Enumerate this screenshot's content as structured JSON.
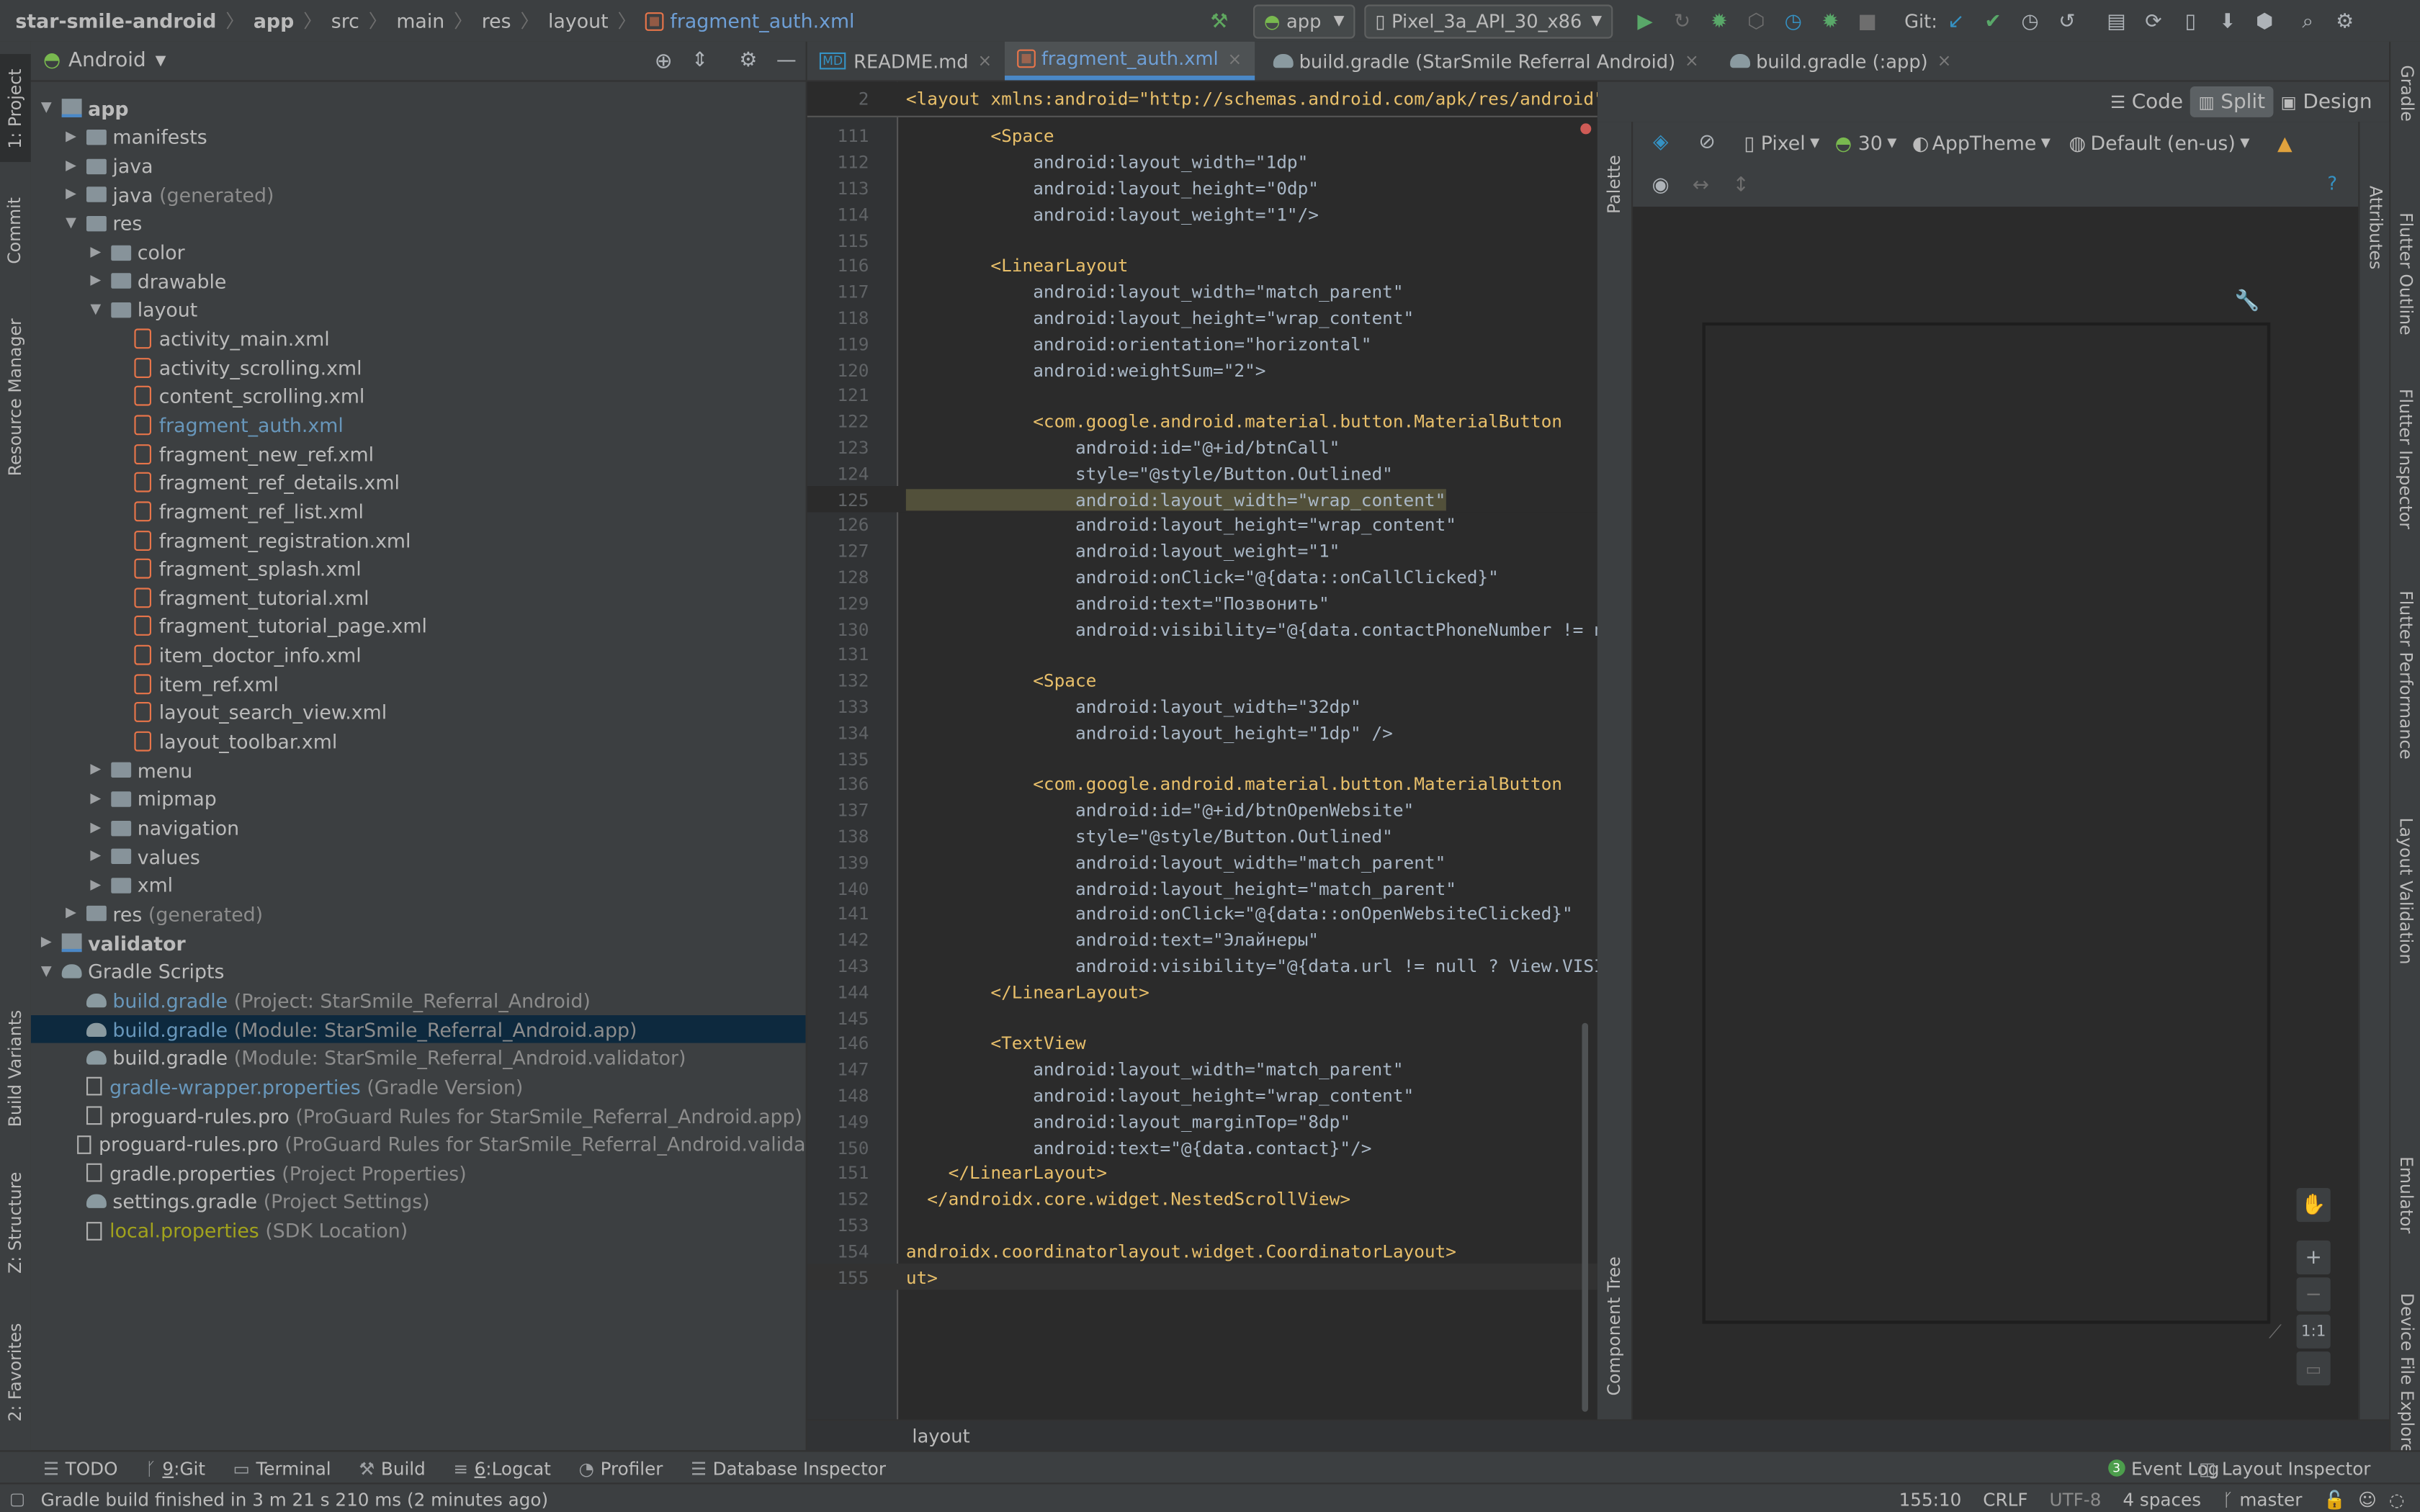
{
  "navbar": {
    "crumbs": [
      "star-smile-android",
      "app",
      "src",
      "main",
      "res",
      "layout",
      "fragment_auth.xml"
    ],
    "run_config": "app",
    "device": "Pixel_3a_API_30_x86",
    "git_label": "Git:"
  },
  "left_stripe": [
    "1: Project",
    "Commit",
    "Resource Manager",
    "Build Variants",
    "Z: Structure",
    "2: Favorites"
  ],
  "right_stripe": [
    "Gradle",
    "Attributes",
    "Flutter Outline",
    "Flutter Inspector",
    "Flutter Performance",
    "Layout Validation",
    "Emulator",
    "Device File Explorer"
  ],
  "project": {
    "view_selector": "Android",
    "rows": [
      {
        "label": "app",
        "depth": 0,
        "arrow": "▼",
        "kind": "module",
        "bold": true
      },
      {
        "label": "manifests",
        "depth": 1,
        "arrow": "▶",
        "kind": "folder"
      },
      {
        "label": "java",
        "depth": 1,
        "arrow": "▶",
        "kind": "folder"
      },
      {
        "label": "java",
        "suffix": "(generated)",
        "depth": 1,
        "arrow": "▶",
        "kind": "folder"
      },
      {
        "label": "res",
        "depth": 1,
        "arrow": "▼",
        "kind": "folder"
      },
      {
        "label": "color",
        "depth": 2,
        "arrow": "▶",
        "kind": "folder"
      },
      {
        "label": "drawable",
        "depth": 2,
        "arrow": "▶",
        "kind": "folder"
      },
      {
        "label": "layout",
        "depth": 2,
        "arrow": "▼",
        "kind": "folder"
      },
      {
        "label": "activity_main.xml",
        "depth": 3,
        "kind": "xml"
      },
      {
        "label": "activity_scrolling.xml",
        "depth": 3,
        "kind": "xml"
      },
      {
        "label": "content_scrolling.xml",
        "depth": 3,
        "kind": "xml"
      },
      {
        "label": "fragment_auth.xml",
        "depth": 3,
        "kind": "xml",
        "color": "blue"
      },
      {
        "label": "fragment_new_ref.xml",
        "depth": 3,
        "kind": "xml"
      },
      {
        "label": "fragment_ref_details.xml",
        "depth": 3,
        "kind": "xml"
      },
      {
        "label": "fragment_ref_list.xml",
        "depth": 3,
        "kind": "xml"
      },
      {
        "label": "fragment_registration.xml",
        "depth": 3,
        "kind": "xml"
      },
      {
        "label": "fragment_splash.xml",
        "depth": 3,
        "kind": "xml"
      },
      {
        "label": "fragment_tutorial.xml",
        "depth": 3,
        "kind": "xml"
      },
      {
        "label": "fragment_tutorial_page.xml",
        "depth": 3,
        "kind": "xml"
      },
      {
        "label": "item_doctor_info.xml",
        "depth": 3,
        "kind": "xml"
      },
      {
        "label": "item_ref.xml",
        "depth": 3,
        "kind": "xml"
      },
      {
        "label": "layout_search_view.xml",
        "depth": 3,
        "kind": "xml"
      },
      {
        "label": "layout_toolbar.xml",
        "depth": 3,
        "kind": "xml"
      },
      {
        "label": "menu",
        "depth": 2,
        "arrow": "▶",
        "kind": "folder"
      },
      {
        "label": "mipmap",
        "depth": 2,
        "arrow": "▶",
        "kind": "folder"
      },
      {
        "label": "navigation",
        "depth": 2,
        "arrow": "▶",
        "kind": "folder"
      },
      {
        "label": "values",
        "depth": 2,
        "arrow": "▶",
        "kind": "folder"
      },
      {
        "label": "xml",
        "depth": 2,
        "arrow": "▶",
        "kind": "folder"
      },
      {
        "label": "res",
        "suffix": "(generated)",
        "depth": 1,
        "arrow": "▶",
        "kind": "folder"
      },
      {
        "label": "validator",
        "depth": 0,
        "arrow": "▶",
        "kind": "module",
        "bold": true
      },
      {
        "label": "Gradle Scripts",
        "depth": 0,
        "arrow": "▼",
        "kind": "gradle"
      },
      {
        "label": "build.gradle",
        "suffix": "(Project: StarSmile_Referral_Android)",
        "depth": 1,
        "kind": "gradle",
        "color": "blue"
      },
      {
        "label": "build.gradle",
        "suffix": "(Module: StarSmile_Referral_Android.app)",
        "depth": 1,
        "kind": "gradle",
        "color": "blue",
        "selected": true
      },
      {
        "label": "build.gradle",
        "suffix": "(Module: StarSmile_Referral_Android.validator)",
        "depth": 1,
        "kind": "gradle"
      },
      {
        "label": "gradle-wrapper.properties",
        "suffix": "(Gradle Version)",
        "depth": 1,
        "kind": "prop",
        "color": "blue"
      },
      {
        "label": "proguard-rules.pro",
        "suffix": "(ProGuard Rules for StarSmile_Referral_Android.app)",
        "depth": 1,
        "kind": "prop"
      },
      {
        "label": "proguard-rules.pro",
        "suffix": "(ProGuard Rules for StarSmile_Referral_Android.valida",
        "depth": 1,
        "kind": "prop"
      },
      {
        "label": "gradle.properties",
        "suffix": "(Project Properties)",
        "depth": 1,
        "kind": "prop"
      },
      {
        "label": "settings.gradle",
        "suffix": "(Project Settings)",
        "depth": 1,
        "kind": "gradle"
      },
      {
        "label": "local.properties",
        "suffix": "(SDK Location)",
        "depth": 1,
        "kind": "prop",
        "color": "olive"
      }
    ]
  },
  "editor_tabs": [
    {
      "label": "README.md",
      "active": false
    },
    {
      "label": "fragment_auth.xml",
      "active": true
    },
    {
      "label": "build.gradle (StarSmile Referral Android)",
      "active": false
    },
    {
      "label": "build.gradle (:app)",
      "active": false
    }
  ],
  "sticky": {
    "line": "2",
    "text": "<layout xmlns:android=\"http://schemas.android.com/apk/res/android\""
  },
  "code": [
    {
      "n": "111",
      "t": "        <Space"
    },
    {
      "n": "112",
      "t": "            android:layout_width=\"1dp\""
    },
    {
      "n": "113",
      "t": "            android:layout_height=\"0dp\""
    },
    {
      "n": "114",
      "t": "            android:layout_weight=\"1\"/>"
    },
    {
      "n": "115",
      "t": ""
    },
    {
      "n": "116",
      "t": "        <LinearLayout"
    },
    {
      "n": "117",
      "t": "            android:layout_width=\"match_parent\""
    },
    {
      "n": "118",
      "t": "            android:layout_height=\"wrap_content\""
    },
    {
      "n": "119",
      "t": "            android:orientation=\"horizontal\""
    },
    {
      "n": "120",
      "t": "            android:weightSum=\"2\">"
    },
    {
      "n": "121",
      "t": ""
    },
    {
      "n": "122",
      "t": "            <com.google.android.material.button.MaterialButton"
    },
    {
      "n": "123",
      "t": "                android:id=\"@+id/btnCall\""
    },
    {
      "n": "124",
      "t": "                style=\"@style/Button.Outlined\""
    },
    {
      "n": "125",
      "t": "                android:layout_width=\"wrap_content\""
    },
    {
      "n": "126",
      "t": "                android:layout_height=\"wrap_content\""
    },
    {
      "n": "127",
      "t": "                android:layout_weight=\"1\""
    },
    {
      "n": "128",
      "t": "                android:onClick=\"@{data::onCallClicked}\""
    },
    {
      "n": "129",
      "t": "                android:text=\"Позвонить\""
    },
    {
      "n": "130",
      "t": "                android:visibility=\"@{data.contactPhoneNumber != nu"
    },
    {
      "n": "131",
      "t": ""
    },
    {
      "n": "132",
      "t": "            <Space"
    },
    {
      "n": "133",
      "t": "                android:layout_width=\"32dp\""
    },
    {
      "n": "134",
      "t": "                android:layout_height=\"1dp\" />"
    },
    {
      "n": "135",
      "t": ""
    },
    {
      "n": "136",
      "t": "            <com.google.android.material.button.MaterialButton"
    },
    {
      "n": "137",
      "t": "                android:id=\"@+id/btnOpenWebsite\""
    },
    {
      "n": "138",
      "t": "                style=\"@style/Button.Outlined\""
    },
    {
      "n": "139",
      "t": "                android:layout_width=\"match_parent\""
    },
    {
      "n": "140",
      "t": "                android:layout_height=\"match_parent\""
    },
    {
      "n": "141",
      "t": "                android:onClick=\"@{data::onOpenWebsiteClicked}\""
    },
    {
      "n": "142",
      "t": "                android:text=\"Элайнеры\""
    },
    {
      "n": "143",
      "t": "                android:visibility=\"@{data.url != null ? View.VISIB"
    },
    {
      "n": "144",
      "t": "        </LinearLayout>"
    },
    {
      "n": "145",
      "t": ""
    },
    {
      "n": "146",
      "t": "        <TextView"
    },
    {
      "n": "147",
      "t": "            android:layout_width=\"match_parent\""
    },
    {
      "n": "148",
      "t": "            android:layout_height=\"wrap_content\""
    },
    {
      "n": "149",
      "t": "            android:layout_marginTop=\"8dp\""
    },
    {
      "n": "150",
      "t": "            android:text=\"@{data.contact}\"/>"
    },
    {
      "n": "151",
      "t": "    </LinearLayout>"
    },
    {
      "n": "152",
      "t": "  </androidx.core.widget.NestedScrollView>"
    },
    {
      "n": "153",
      "t": ""
    },
    {
      "n": "154",
      "t": "androidx.coordinatorlayout.widget.CoordinatorLayout>"
    },
    {
      "n": "155",
      "t": "ut>"
    }
  ],
  "design": {
    "modes": [
      "Code",
      "Split",
      "Design"
    ],
    "active_mode": "Split",
    "device": "Pixel",
    "api": "30",
    "theme": "AppTheme",
    "locale": "Default (en-us)",
    "palette_label": "Palette",
    "component_tree_label": "Component Tree",
    "zoom_reset": "1:1"
  },
  "breadcrumb": "layout",
  "bottom_tabs": [
    {
      "key": "",
      "label": "TODO",
      "icon": "☰"
    },
    {
      "key": "9",
      "label": "Git",
      "icon": "ᚴ"
    },
    {
      "key": "",
      "label": "Terminal",
      "icon": "▭"
    },
    {
      "key": "",
      "label": "Build",
      "icon": "⚒"
    },
    {
      "key": "6",
      "label": "Logcat",
      "icon": "≡"
    },
    {
      "key": "",
      "label": "Profiler",
      "icon": "◔"
    },
    {
      "key": "",
      "label": "Database Inspector",
      "icon": "☰"
    }
  ],
  "bottom_right_tabs": [
    {
      "label": "Event Log",
      "badge": "3"
    },
    {
      "label": "Layout Inspector",
      "badge": ""
    }
  ],
  "status": {
    "message": "Gradle build finished in 3 m 21 s 210 ms (2 minutes ago)",
    "position": "155:10",
    "line_sep": "CRLF",
    "encoding": "UTF-8",
    "indent": "4 spaces",
    "branch": "master"
  }
}
